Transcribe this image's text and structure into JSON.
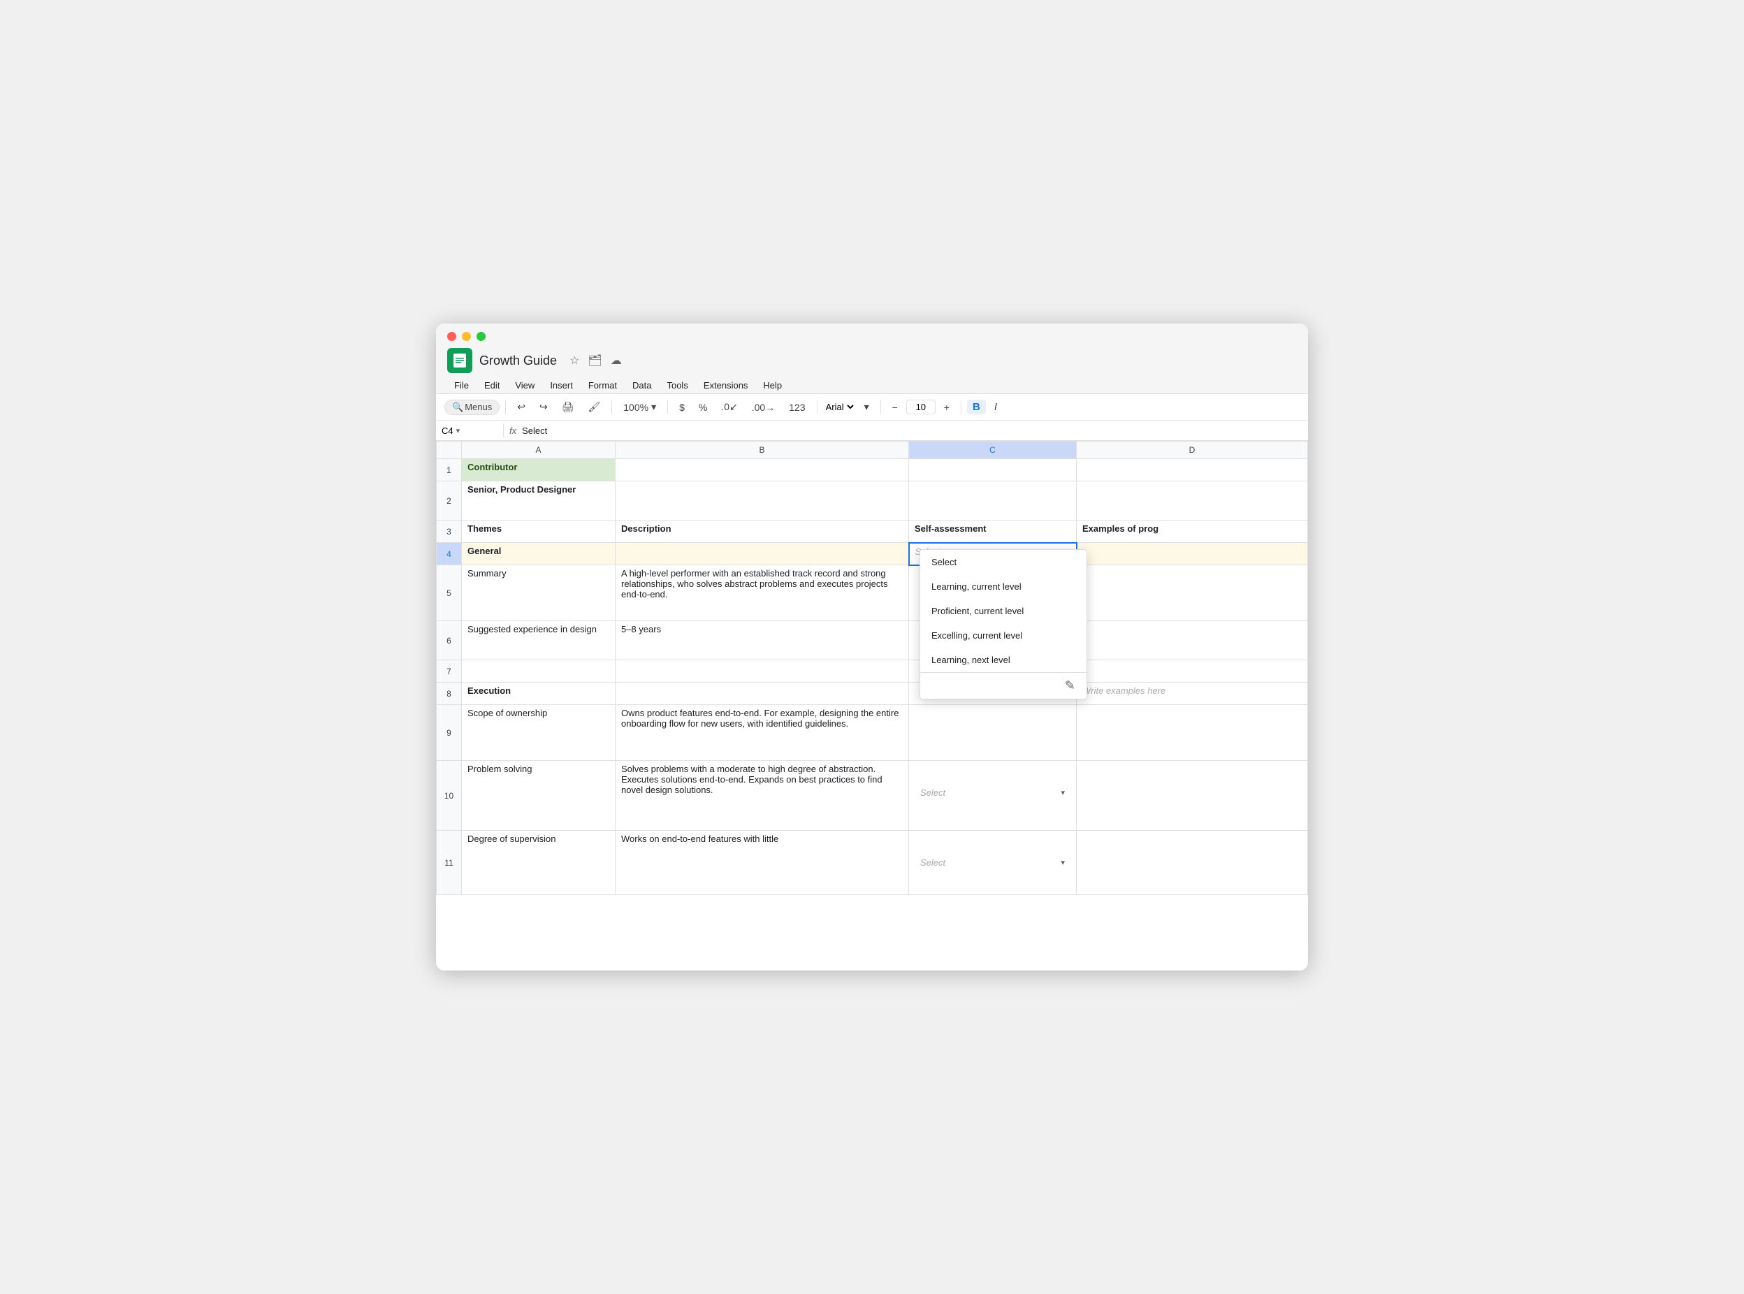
{
  "window": {
    "title": "Growth Guide"
  },
  "app": {
    "name": "Growth Guide",
    "icon_label": "Google Sheets icon"
  },
  "menu": {
    "items": [
      "File",
      "Edit",
      "View",
      "Insert",
      "Format",
      "Data",
      "Tools",
      "Extensions",
      "Help"
    ]
  },
  "toolbar": {
    "menus_label": "Menus",
    "zoom": "100%",
    "font": "Arial",
    "font_size": "10",
    "bold": "B",
    "italic": "I"
  },
  "formula_bar": {
    "cell_ref": "C4",
    "fx": "fx",
    "value": "Select"
  },
  "columns": {
    "row_header": "",
    "A": "A",
    "B": "B",
    "C": "C",
    "D": "D"
  },
  "rows": [
    {
      "num": "1",
      "A": "Contributor",
      "B": "",
      "C": "",
      "D": ""
    },
    {
      "num": "2",
      "A": "Senior, Product Designer",
      "B": "",
      "C": "",
      "D": ""
    },
    {
      "num": "3",
      "A": "Themes",
      "B": "Description",
      "C": "Self-assessment",
      "D": "Examples of prog"
    },
    {
      "num": "4",
      "A": "General",
      "B": "",
      "C": "Select",
      "D": ""
    },
    {
      "num": "5",
      "A": "Summary",
      "B": "A high-level performer with an established track record and strong relationships, who solves abstract problems and executes projects end-to-end.",
      "C": "",
      "D": ""
    },
    {
      "num": "6",
      "A": "Suggested experience in design",
      "B": "5–8 years",
      "C": "",
      "D": ""
    },
    {
      "num": "7",
      "A": "",
      "B": "",
      "C": "",
      "D": ""
    },
    {
      "num": "8",
      "A": "Execution",
      "B": "",
      "C": "",
      "D": "Write examples here"
    },
    {
      "num": "9",
      "A": "Scope of ownership",
      "B": "Owns product features end-to-end. For example, designing the entire onboarding flow for new users, with identified guidelines.",
      "C": "",
      "D": ""
    },
    {
      "num": "10",
      "A": "Problem solving",
      "B": "Solves problems with a moderate to high degree of abstraction. Executes solutions end-to-end. Expands on best practices to find novel design solutions.",
      "C": "Select",
      "D": ""
    },
    {
      "num": "11",
      "A": "Degree of supervision",
      "B": "Works on end-to-end features with little",
      "C": "Select",
      "D": ""
    }
  ],
  "dropdown": {
    "items": [
      "Select",
      "Learning, current level",
      "Proficient, current level",
      "Excelling, current level",
      "Learning, next level"
    ]
  }
}
